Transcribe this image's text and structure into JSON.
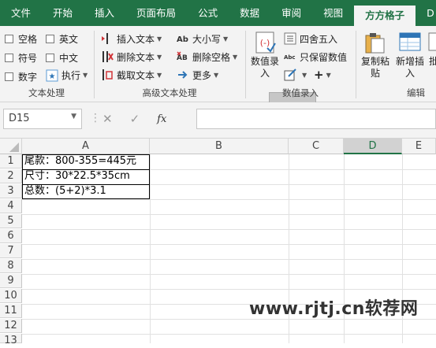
{
  "tabs": [
    "文件",
    "开始",
    "插入",
    "页面布局",
    "公式",
    "数据",
    "审阅",
    "视图",
    "方方格子",
    "D"
  ],
  "active_tab": "方方格子",
  "groups": {
    "text_process": {
      "label": "文本处理",
      "checkboxes": [
        "空格",
        "英文",
        "符号",
        "中文",
        "数字"
      ],
      "exec": "执行"
    },
    "advanced_text": {
      "label": "高级文本处理",
      "insert_text": "插入文本",
      "delete_text": "删除文本",
      "cut_text": "截取文本",
      "case": "大小写",
      "delete_space": "删除空格",
      "more": "更多"
    },
    "numeric_entry": {
      "label": "数值录入",
      "numeric_entry_btn": "数值录\n入",
      "round": "四舍五入",
      "keep_numeric": "只保留数值",
      "plus": "+"
    },
    "edit": {
      "label": "编辑",
      "copy_paste": "复制粘\n贴",
      "new_insert": "新增插\n入",
      "batch": "批"
    }
  },
  "formula_bar": {
    "name_box": "D15",
    "fx": "fx",
    "value": ""
  },
  "columns": [
    "A",
    "B",
    "C",
    "D",
    "E"
  ],
  "selected_column": "D",
  "rows": [
    "1",
    "2",
    "3",
    "4",
    "5",
    "6",
    "7",
    "8",
    "9",
    "10",
    "11",
    "12",
    "13"
  ],
  "cells": [
    "尾款：800-355=445元",
    "尺寸：30*22.5*35cm",
    "总数：(5+2)*3.1"
  ],
  "watermark": "www.rjtj.cn软荐网"
}
